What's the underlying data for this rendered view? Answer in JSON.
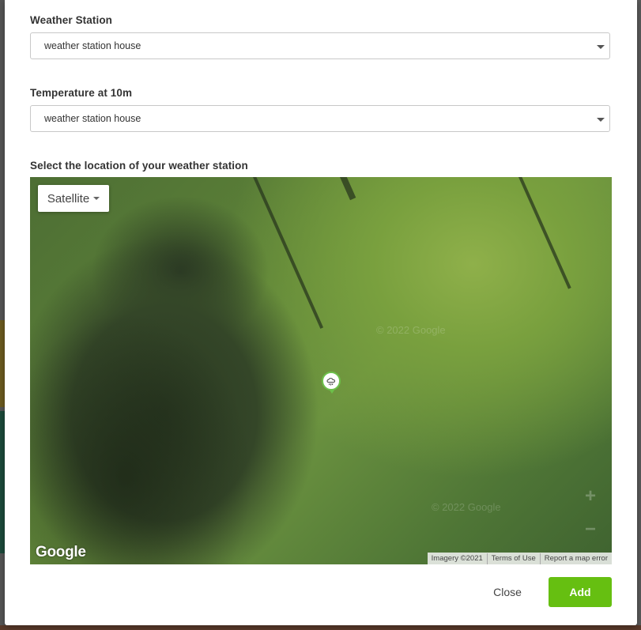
{
  "weather_station": {
    "label": "Weather Station",
    "selected": "weather station house"
  },
  "temperature": {
    "label": "Temperature at 10m",
    "selected": "weather station house"
  },
  "location": {
    "label": "Select the location of your weather station"
  },
  "map": {
    "type_control": "Satellite",
    "logo": "Google",
    "watermark": "© 2022 Google",
    "attribution": {
      "imagery": "Imagery ©2021",
      "terms": "Terms of Use",
      "report": "Report a map error"
    },
    "marker_icon": "weather-station-icon"
  },
  "footer": {
    "close_label": "Close",
    "add_label": "Add"
  },
  "colors": {
    "accent": "#66bf11",
    "marker_ring": "#6cc04a"
  }
}
